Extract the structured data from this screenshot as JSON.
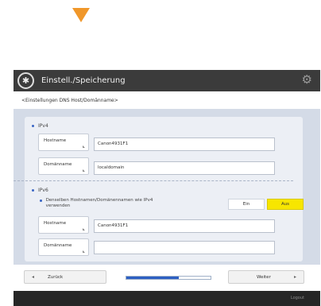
{
  "window": {
    "title": "Einstell./Speicherung",
    "logo_glyph": "✱",
    "settings_glyph": "⚙"
  },
  "screen": {
    "subtitle": "<Einstellungen DNS Host/Domänname>"
  },
  "ipv4": {
    "label": "IPv4",
    "hostname_label": "Hostname",
    "hostname_value": "Canon4931F1",
    "domain_label": "Domänname",
    "domain_value": "localdomain"
  },
  "ipv6": {
    "label": "IPv6",
    "same_name_label": "Denselben Hostnamen/Domänennamen wie IPv4 verwenden",
    "toggle_on_label": "Ein",
    "toggle_off_label": "Aus",
    "toggle_selected": "Aus",
    "hostname_label": "Hostname",
    "hostname_value": "Canon4931F1",
    "domain_label": "Domänname",
    "domain_value": ""
  },
  "footer": {
    "back_label": "Zurück",
    "back_glyph": "◂",
    "next_label": "Weiter",
    "next_glyph": "▸",
    "progress_fraction": 0.62
  },
  "status": {
    "logout_label": "Logout"
  },
  "colors": {
    "accent_arrow": "#f0972a",
    "selected_toggle": "#f7e600",
    "progress": "#2d5fc2",
    "bullet": "#3a66c4"
  }
}
